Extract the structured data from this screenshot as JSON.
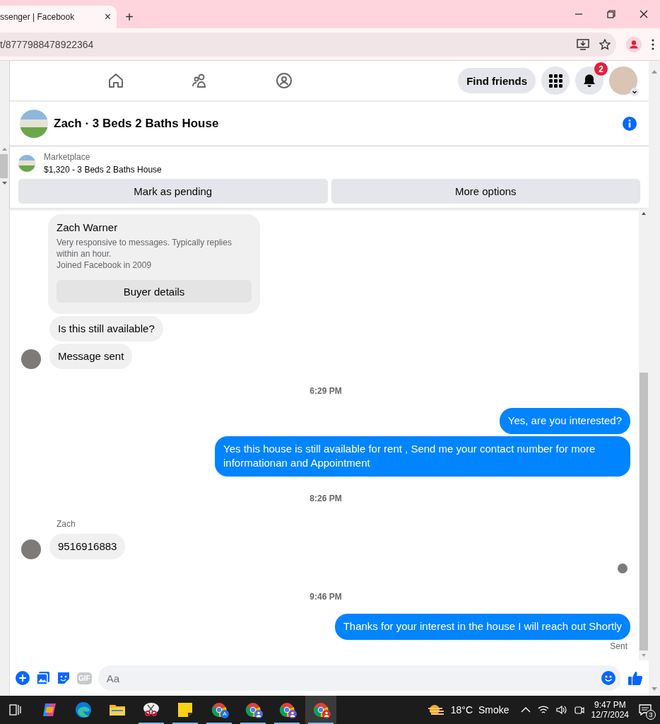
{
  "browser": {
    "tab": {
      "title": "ssenger | Facebook",
      "close": "×",
      "selected": true
    },
    "new_tab": "+",
    "address": "t/8777988478922364"
  },
  "nav": {
    "find_friends": "Find friends",
    "notifications_badge": "2"
  },
  "chat": {
    "title": "Zach · 3 Beds 2 Baths House",
    "listing": {
      "label": "Marketplace",
      "title": "$1,320 - 3 Beds 2 Baths House"
    },
    "actions": [
      "Mark as pending",
      "More options"
    ],
    "messages": [
      {
        "kind": "profile_card",
        "name": "Zach Warner",
        "lines": [
          "Very responsive to messages. Typically replies within an hour.",
          "Joined Facebook in 2009"
        ],
        "button": "Buyer details"
      },
      {
        "kind": "incoming",
        "text": "Is this still available?",
        "avatar": false
      },
      {
        "kind": "incoming",
        "text": "Message sent",
        "avatar": true
      },
      {
        "kind": "time",
        "text": "6:29 PM"
      },
      {
        "kind": "outgoing",
        "text": "Yes, are you interested?"
      },
      {
        "kind": "outgoing",
        "text": "Yes this house is still available for rent , Send me your contact number for more informationan and Appointment"
      },
      {
        "kind": "time",
        "text": "8:26 PM"
      },
      {
        "kind": "sender",
        "text": "Zach"
      },
      {
        "kind": "incoming",
        "text": "9516916883",
        "avatar": true
      },
      {
        "kind": "seen"
      },
      {
        "kind": "time",
        "text": "9:46 PM"
      },
      {
        "kind": "outgoing",
        "text": "Thanks for your interest in the house I will reach out Shortly"
      },
      {
        "kind": "status",
        "text": "Sent"
      }
    ],
    "composer": {
      "gif": "GIF",
      "placeholder": "Aa"
    }
  },
  "taskbar": {
    "apps": [
      {
        "kind": "copilot",
        "running": false,
        "selected": false
      },
      {
        "kind": "edge",
        "running": false,
        "selected": false
      },
      {
        "kind": "folder",
        "running": false,
        "selected": false
      },
      {
        "kind": "snip",
        "running": true,
        "selected": false
      },
      {
        "kind": "note",
        "running": true,
        "selected": false
      },
      {
        "kind": "chrome",
        "running": true,
        "selected": false,
        "badge": "A",
        "color": "#1a73e8"
      },
      {
        "kind": "chrome",
        "running": true,
        "selected": false,
        "color": "#4a6fd8"
      },
      {
        "kind": "chrome",
        "running": true,
        "selected": false,
        "color": "#7b52c8"
      },
      {
        "kind": "chrome",
        "running": true,
        "selected": true,
        "color": "#d93025"
      }
    ],
    "weather": {
      "temp": "18°C",
      "condition": "Smoke"
    },
    "time": "9:47 PM",
    "date": "12/7/2024",
    "notifications": "3"
  }
}
